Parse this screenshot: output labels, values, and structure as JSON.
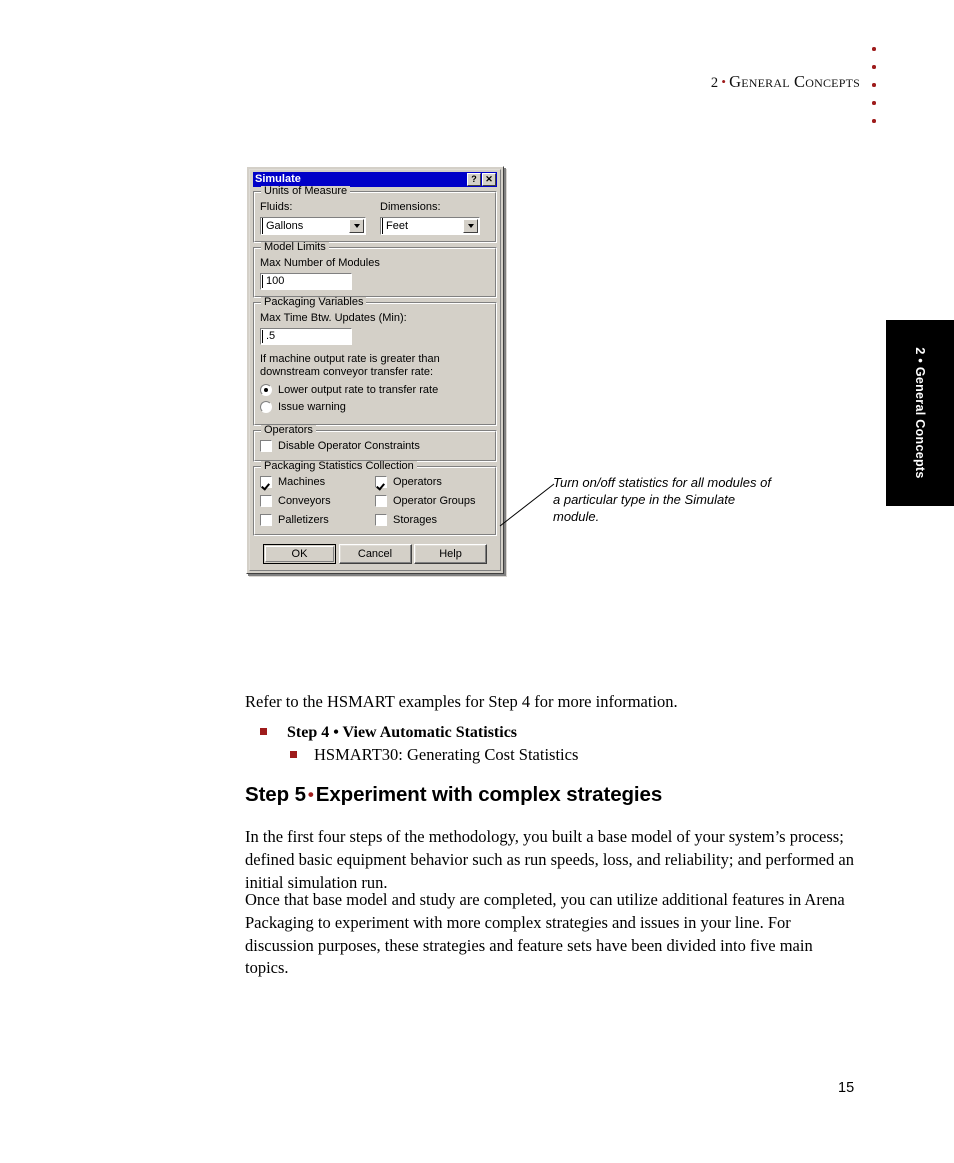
{
  "header": {
    "chapter_number": "2",
    "separator": "•",
    "title": "General Concepts",
    "dot_count": 5,
    "dot_color": "#9e1b1b"
  },
  "side_tab": {
    "label": "2 • General Concepts",
    "background": "#000000",
    "text_color": "#ffffff"
  },
  "dialog": {
    "title": "Simulate",
    "titlebar_color": "#0000c8",
    "face_color": "#d4d0c8",
    "help_button": "?",
    "close_button": "✕",
    "units_of_measure": {
      "group_title": "Units of Measure",
      "fluids_label": "Fluids:",
      "fluids_value": "Gallons",
      "dimensions_label": "Dimensions:",
      "dimensions_value": "Feet"
    },
    "model_limits": {
      "group_title": "Model Limits",
      "max_modules_label": "Max Number of Modules",
      "max_modules_value": "100"
    },
    "packaging_variables": {
      "group_title": "Packaging Variables",
      "max_time_label": "Max Time Btw. Updates (Min):",
      "max_time_value": ".5",
      "note_line1": "If machine output rate is greater than",
      "note_line2": "downstream conveyor transfer rate:",
      "radios": [
        {
          "label": "Lower output rate to transfer rate",
          "selected": true
        },
        {
          "label": "Issue warning",
          "selected": false
        }
      ]
    },
    "operators": {
      "group_title": "Operators",
      "checkbox_label": "Disable Operator Constraints",
      "checked": false
    },
    "packaging_statistics": {
      "group_title": "Packaging Statistics Collection",
      "left_column": [
        {
          "label": "Machines",
          "checked": true
        },
        {
          "label": "Conveyors",
          "checked": false
        },
        {
          "label": "Palletizers",
          "checked": false
        }
      ],
      "right_column": [
        {
          "label": "Operators",
          "checked": true
        },
        {
          "label": "Operator Groups",
          "checked": false
        },
        {
          "label": "Storages",
          "checked": false
        }
      ]
    },
    "buttons": {
      "ok": "OK",
      "cancel": "Cancel",
      "help": "Help"
    }
  },
  "callout": {
    "line1": "Turn on/off statistics for all modules of",
    "line2": "a particular type in the Simulate",
    "line3": "module."
  },
  "body": {
    "para_refer": "Refer to the HSMART examples for Step 4 for more information.",
    "bullet_level1": "Step 4 • View Automatic Statistics",
    "bullet_level2": "HSMART30:  Generating Cost Statistics",
    "step5_heading_pre": "Step 5",
    "step5_heading_post": "Experiment with complex strategies",
    "para_1": "In the first four steps of the methodology, you built a base model of your system’s process; defined basic equipment behavior such as run speeds, loss, and reliability; and performed an initial simulation run.",
    "para_2": "Once that base model and study are completed, you can utilize additional features in Arena Packaging to experiment with more complex strategies and issues in your line. For discussion purposes, these strategies and feature sets have been divided into five main topics."
  },
  "footer": {
    "page_number": "15"
  }
}
